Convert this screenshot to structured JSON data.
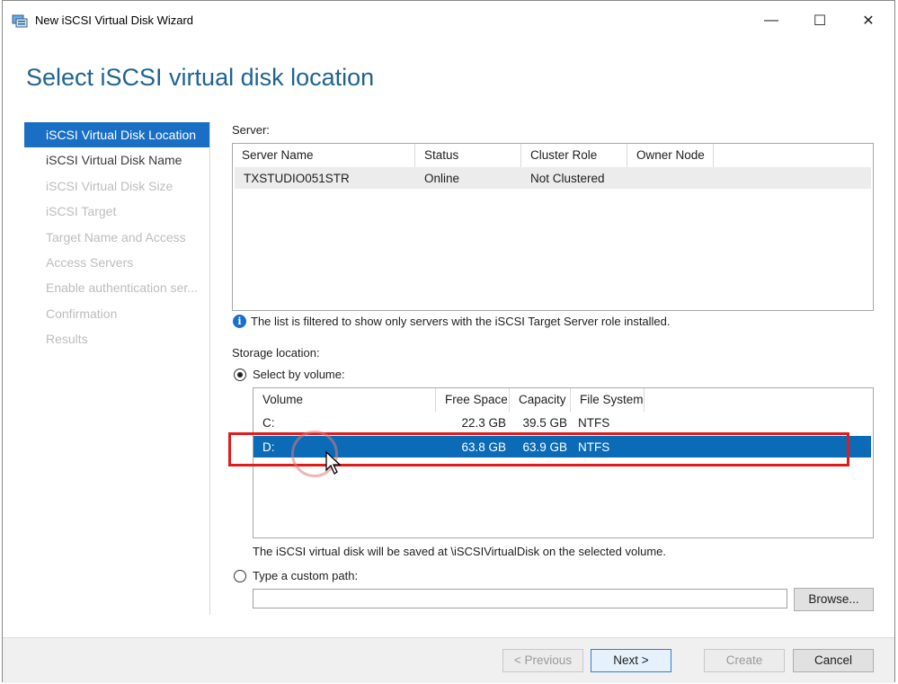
{
  "window": {
    "title": "New iSCSI Virtual Disk Wizard",
    "minimize_label": "—",
    "maximize_label": "☐",
    "close_label": "✕"
  },
  "header": {
    "title": "Select iSCSI virtual disk location"
  },
  "nav": {
    "items": [
      {
        "label": "iSCSI Virtual Disk Location",
        "state": "active"
      },
      {
        "label": "iSCSI Virtual Disk Name",
        "state": "enabled"
      },
      {
        "label": "iSCSI Virtual Disk Size",
        "state": "disabled"
      },
      {
        "label": "iSCSI Target",
        "state": "disabled"
      },
      {
        "label": "Target Name and Access",
        "state": "disabled"
      },
      {
        "label": "Access Servers",
        "state": "disabled"
      },
      {
        "label": "Enable authentication ser...",
        "state": "disabled"
      },
      {
        "label": "Confirmation",
        "state": "disabled"
      },
      {
        "label": "Results",
        "state": "disabled"
      }
    ]
  },
  "server": {
    "label": "Server:",
    "columns": [
      "Server Name",
      "Status",
      "Cluster Role",
      "Owner Node"
    ],
    "rows": [
      {
        "name": "TXSTUDIO051STR",
        "status": "Online",
        "cluster_role": "Not Clustered",
        "owner_node": ""
      }
    ],
    "info_text": "The list is filtered to show only servers with the iSCSI Target Server role installed."
  },
  "storage": {
    "label": "Storage location:",
    "select_by_volume_label": "Select by volume:",
    "volume_columns": [
      "Volume",
      "Free Space",
      "Capacity",
      "File System"
    ],
    "volumes": [
      {
        "volume": "C:",
        "free_space": "22.3 GB",
        "capacity": "39.5 GB",
        "file_system": "NTFS"
      },
      {
        "volume": "D:",
        "free_space": "63.8 GB",
        "capacity": "63.9 GB",
        "file_system": "NTFS"
      }
    ],
    "selected_volume": "D:",
    "save_note": "The iSCSI virtual disk will be saved at \\iSCSIVirtualDisk on the selected volume.",
    "custom_path_label": "Type a custom path:",
    "custom_path_value": "",
    "browse_label": "Browse..."
  },
  "footer": {
    "previous_label": "< Previous",
    "next_label": "Next >",
    "create_label": "Create",
    "cancel_label": "Cancel"
  },
  "colors": {
    "accent": "#1a6fc4",
    "selection": "#0b6bb6",
    "title": "#1f6391",
    "highlight": "#e01b1b"
  }
}
